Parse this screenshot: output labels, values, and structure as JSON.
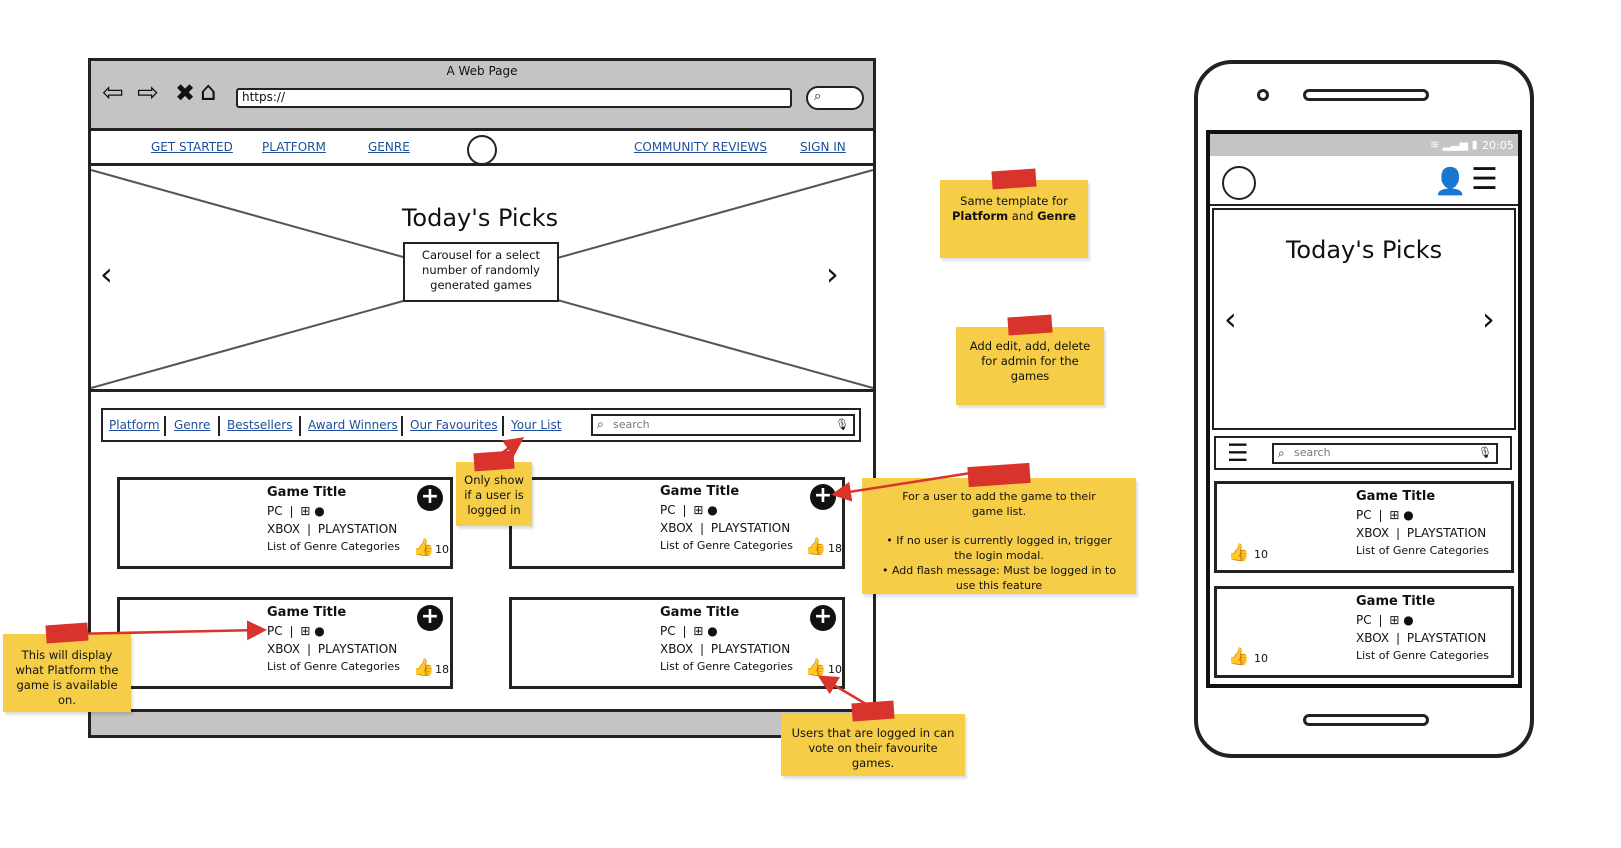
{
  "browser": {
    "title": "A Web Page",
    "url": "https://"
  },
  "nav": {
    "items": [
      "GET STARTED",
      "PLATFORM",
      "GENRE",
      "COMMUNITY REVIEWS",
      "SIGN IN"
    ]
  },
  "hero": {
    "title": "Today's Picks",
    "caption": "Carousel for a select number of randomly generated games"
  },
  "filters": [
    "Platform",
    "Genre",
    "Bestsellers",
    "Award Winners",
    "Our Favourites",
    "Your List"
  ],
  "search": {
    "placeholder": "search"
  },
  "cards": [
    {
      "title": "Game Title",
      "platform1": "PC",
      "platform2": "XBOX",
      "platform3": "PLAYSTATION",
      "genres": "List of Genre Categories",
      "votes": "10"
    },
    {
      "title": "Game Title",
      "platform1": "PC",
      "platform2": "XBOX",
      "platform3": "PLAYSTATION",
      "genres": "List of Genre Categories",
      "votes": "18"
    },
    {
      "title": "Game Title",
      "platform1": "PC",
      "platform2": "XBOX",
      "platform3": "PLAYSTATION",
      "genres": "List of Genre Categories",
      "votes": "18"
    },
    {
      "title": "Game Title",
      "platform1": "PC",
      "platform2": "XBOX",
      "platform3": "PLAYSTATION",
      "genres": "List of Genre Categories",
      "votes": "10"
    }
  ],
  "notes": {
    "template": "Same template for Platform and Genre",
    "template_a": "Same template for",
    "template_b1": "Platform",
    "template_b2": " and ",
    "template_b3": "Genre",
    "admin": "Add edit, add, delete for admin for the games",
    "loggedin": "Only show if a user is logged in",
    "add_main": "For a user to add the game to their game list.",
    "add_b1": "If no user is currently logged in, trigger the login modal.",
    "add_b2": "Add flash message: Must be logged in to use this feature",
    "platform": "This will display what Platform the game is available on.",
    "vote": "Users that are logged in can vote on their favourite games."
  },
  "mobile": {
    "time": "20:05",
    "hero_title": "Today's Picks",
    "search_placeholder": "search",
    "cards": [
      {
        "title": "Game Title",
        "platform1": "PC",
        "platform2": "XBOX",
        "platform3": "PLAYSTATION",
        "genres": "List of Genre Categories",
        "votes": "10"
      },
      {
        "title": "Game Title",
        "platform1": "PC",
        "platform2": "XBOX",
        "platform3": "PLAYSTATION",
        "genres": "List of Genre Categories",
        "votes": "10"
      }
    ]
  },
  "colors": {
    "note": "#f5cd47",
    "tape": "#d9342b",
    "arrow": "#d9342b",
    "link": "#1f4f9a",
    "chrome": "#c4c4c4"
  }
}
